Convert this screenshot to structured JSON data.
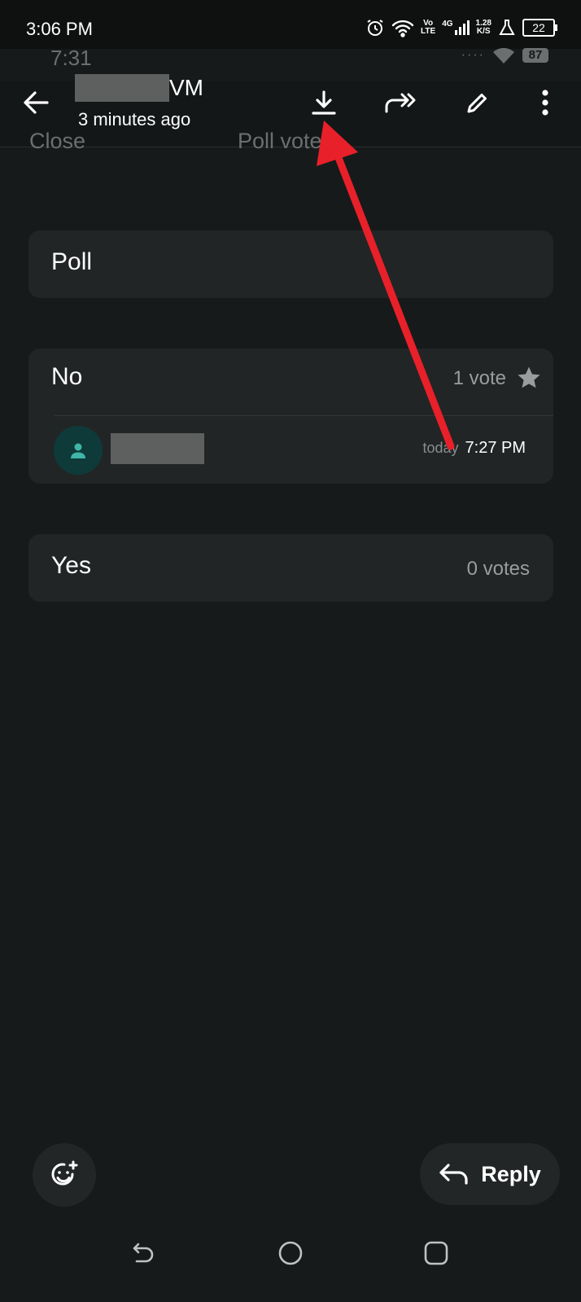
{
  "status_bar": {
    "time": "3:06 PM",
    "network_top": "Vo",
    "network_bottom": "LTE",
    "network_gen": "4G",
    "speed_top": "1.28",
    "speed_bottom": "K/S",
    "battery": "22"
  },
  "ghost_status": {
    "time": "7:31",
    "battery": "87"
  },
  "ghost_header": {
    "close_label": "Close",
    "title": "Poll votes"
  },
  "header": {
    "name_suffix": "VM",
    "subtitle": "3 minutes ago",
    "icons": [
      "back-arrow-icon",
      "download-icon",
      "forward-icon",
      "edit-pencil-icon",
      "more-vertical-icon"
    ]
  },
  "poll": {
    "title": "Poll",
    "options": [
      {
        "label": "No",
        "votes_text": "1 vote",
        "starred": true,
        "voters": [
          {
            "day": "today",
            "time": "7:27 PM"
          }
        ]
      },
      {
        "label": "Yes",
        "votes_text": "0 votes"
      }
    ]
  },
  "actions": {
    "reply_label": "Reply"
  },
  "colors": {
    "background": "#171a1a",
    "card": "#222525",
    "annotation_arrow": "#e8202a",
    "avatar_accent": "#3fb5a8"
  }
}
